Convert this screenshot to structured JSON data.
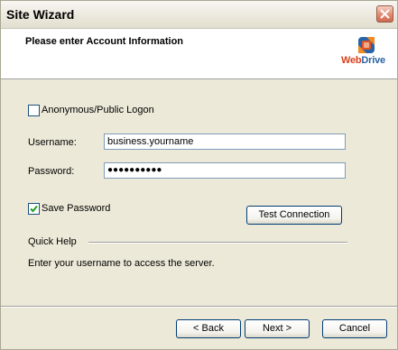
{
  "window": {
    "title": "Site Wizard"
  },
  "header": {
    "title": "Please enter Account Information",
    "logo": {
      "brand_part1": "Web",
      "brand_part2": "Drive",
      "colors": {
        "web": "#d9401a",
        "drive": "#2a64a8"
      }
    }
  },
  "form": {
    "anonymous": {
      "label": "Anonymous/Public Logon",
      "checked": false
    },
    "username": {
      "label": "Username:",
      "value": "business.yourname"
    },
    "password": {
      "label": "Password:",
      "value": "●●●●●●●●●●"
    },
    "save_password": {
      "label": "Save Password",
      "checked": true
    },
    "test_connection": "Test Connection"
  },
  "quick_help": {
    "title": "Quick Help",
    "text": "Enter your username to access the server."
  },
  "buttons": {
    "back": "< Back",
    "next": "Next >",
    "cancel": "Cancel"
  }
}
